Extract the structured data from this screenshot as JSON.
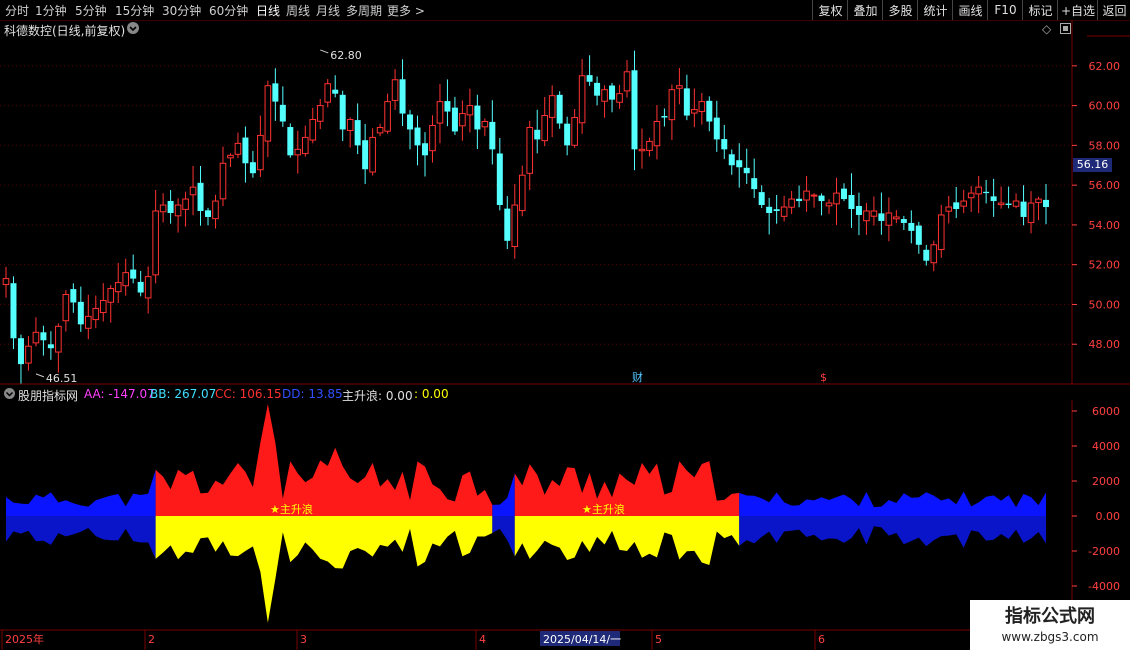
{
  "toolbar": {
    "periods": [
      "分时",
      "1分钟",
      "5分钟",
      "15分钟",
      "30分钟",
      "60分钟",
      "日线",
      "周线",
      "月线",
      "多周期",
      "更多 >"
    ],
    "active": "日线",
    "right_buttons": [
      "复权",
      "叠加",
      "多股",
      "统计",
      "画线",
      "F10",
      "标记",
      "+自选",
      "返回"
    ]
  },
  "main": {
    "title": "科德数控(日线,前复权)",
    "high_label": "62.80",
    "low_label": "46.51",
    "price_flag": "56.16",
    "y_ticks": [
      "62.00",
      "60.00",
      "58.00",
      "56.00",
      "54.00",
      "52.00",
      "50.00",
      "48.00"
    ],
    "markers": [
      "财",
      "$"
    ]
  },
  "indicator": {
    "name": "股朋指标网",
    "aa": "AA: -147.07",
    "bb": "BB: 267.07",
    "cc": "CC: 106.15",
    "dd": "DD: 13.85",
    "zsl": "主升浪: 0.00",
    "zsl2": ": 0.00",
    "y_ticks": [
      "6000",
      "4000",
      "2000",
      "0.00",
      "-2000",
      "-4000"
    ],
    "zsl_label": "主升浪"
  },
  "xaxis": {
    "labels": [
      "2025年",
      "2",
      "3",
      "4",
      "5",
      "6"
    ],
    "cursor_date": "2025/04/14/一"
  },
  "watermark": {
    "line1": "指标公式网",
    "line2": "www.zbgs3.com"
  },
  "colors": {
    "up": "#ff3232",
    "down": "#54ffff",
    "red_area": "#ff1a1a",
    "blue_area": "#0a14ff",
    "yellow_area": "#ffff00",
    "axis": "#ff4040"
  },
  "chart_data": {
    "type": "candlestick",
    "closes": [
      51.3,
      48.3,
      47.0,
      47.9,
      48.6,
      48.2,
      47.8,
      48.9,
      50.5,
      50.1,
      49.0,
      49.4,
      49.8,
      50.2,
      50.8,
      51.1,
      51.6,
      51.3,
      50.6,
      51.4,
      54.7,
      55.0,
      54.6,
      55.0,
      55.3,
      55.9,
      54.7,
      54.4,
      55.2,
      57.1,
      57.5,
      58.1,
      57.1,
      56.6,
      58.5,
      61.0,
      60.2,
      59.2,
      57.5,
      57.8,
      58.4,
      59.3,
      60.0,
      61.1,
      60.6,
      58.8,
      59.3,
      58.0,
      56.8,
      58.4,
      58.9,
      60.2,
      61.3,
      59.6,
      58.8,
      58.0,
      57.5,
      59.0,
      60.2,
      59.7,
      58.7,
      59.6,
      60.0,
      58.8,
      59.2,
      57.8,
      55.0,
      53.2,
      55.0,
      56.5,
      58.9,
      58.3,
      59.5,
      60.5,
      59.1,
      58.0,
      59.4,
      61.5,
      61.2,
      60.5,
      60.8,
      60.3,
      60.6,
      61.7,
      57.8,
      57.8,
      58.2,
      59.2,
      59.4,
      60.8,
      61.0,
      59.5,
      59.8,
      60.2,
      59.2,
      58.3,
      57.8,
      57.0,
      56.9,
      56.6,
      55.8,
      55.0,
      54.6,
      54.7,
      54.9,
      55.3,
      55.2,
      55.7,
      55.5,
      55.2,
      55.1,
      55.6,
      55.3,
      54.8,
      54.5,
      54.7,
      54.7,
      54.2,
      54.6,
      54.4,
      54.1,
      53.7,
      53.0,
      52.2,
      53.0,
      54.5,
      54.9,
      54.8,
      55.2,
      55.6,
      55.9,
      55.6,
      55.2,
      55.1,
      55.0,
      55.2,
      54.4,
      55.1,
      55.3,
      54.9
    ],
    "y_range": [
      46.0,
      63.5
    ],
    "high": 62.8,
    "low": 46.51,
    "current": 56.16,
    "indicator_range": [
      -6000,
      7000
    ]
  }
}
